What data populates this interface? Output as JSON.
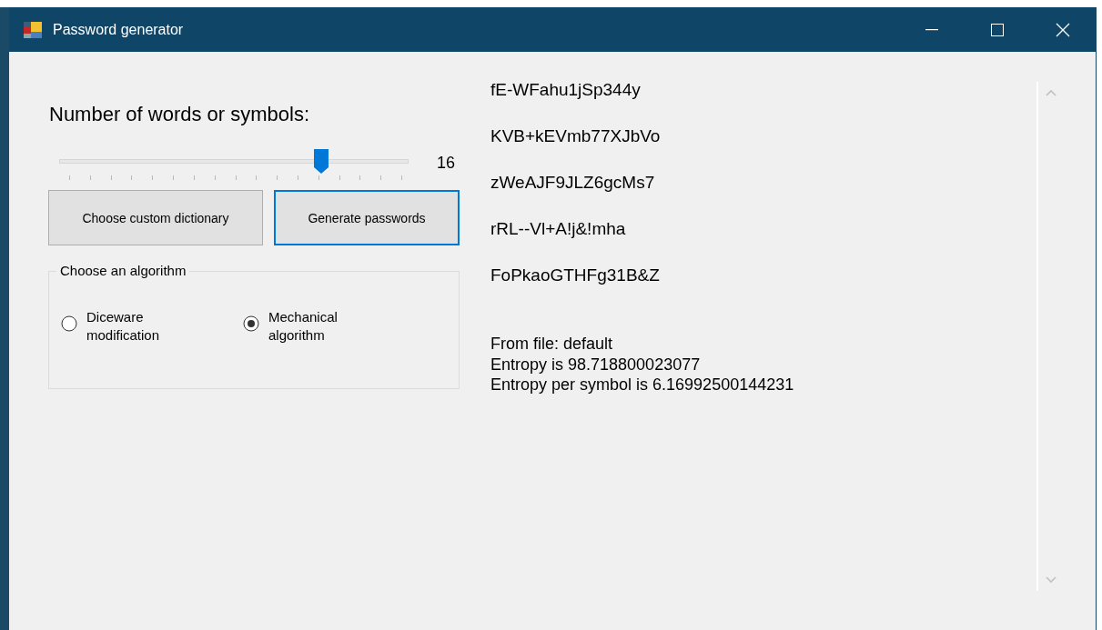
{
  "window": {
    "title": "Password generator"
  },
  "words_label": "Number of words or symbols:",
  "slider": {
    "level": 0.75,
    "reading": "16"
  },
  "buttons": [
    {
      "label": "Choose custom dictionary",
      "focused": false
    },
    {
      "label": "Generate passwords",
      "focused": true
    }
  ],
  "algorithm_group": {
    "title": "Choose an algorithm",
    "options": [
      {
        "label": "Diceware modification",
        "selected": false
      },
      {
        "label": "Mechanical algorithm",
        "selected": true
      }
    ]
  },
  "passwords": [
    "fE-WFahu1jSp344y",
    "KVB+kEVmb77XJbVo",
    "zWeAJF9JLZ6gcMs7",
    "rRL--Vl+A!j&!mha",
    "FoPkaoGTHFg31B&Z"
  ],
  "info_lines": [
    "From file: default",
    "Entropy is 98.718800023077",
    "Entropy per symbol is 6.16992500144231"
  ]
}
